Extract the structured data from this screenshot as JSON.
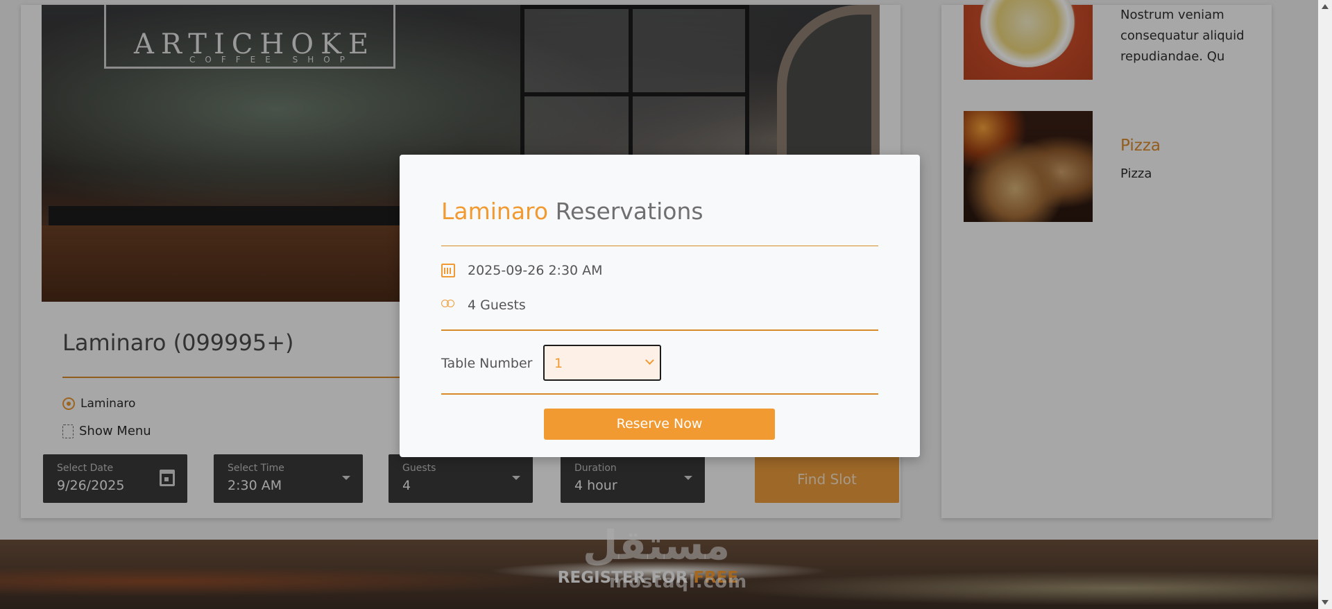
{
  "restaurant": {
    "title": "Laminaro (099995+)",
    "location": "Laminaro",
    "show_menu": "Show Menu"
  },
  "hero": {
    "sign_main": "ARTICHOKE",
    "sign_sub": "COFFEE SHOP"
  },
  "search": {
    "date_label": "Select Date",
    "date_value": "9/26/2025",
    "time_label": "Select Time",
    "time_value": "2:30 AM",
    "guests_label": "Guests",
    "guests_value": "4",
    "duration_label": "Duration",
    "duration_value": "4 hour",
    "find_button": "Find Slot"
  },
  "sidebar": {
    "item1_text": "Nostrum veniam consequatur aliquid repudiandae. Qu",
    "item2_title": "Pizza",
    "item2_text": "Pizza"
  },
  "footer": {
    "register": "REGISTER FOR",
    "free": "FREE",
    "watermark": "مستقل",
    "watermark_sub": "mostaql.com"
  },
  "modal": {
    "title_brand": "Laminaro",
    "title_rest": "Reservations",
    "datetime": "2025-09-26 2:30 AM",
    "guests": "4 Guests",
    "table_label": "Table Number",
    "table_value": "1",
    "reserve_button": "Reserve Now"
  },
  "colors": {
    "accent": "#f29a32",
    "dark_field": "#393939"
  },
  "icons": [
    "location-icon",
    "menu-icon",
    "calendar-icon",
    "guests-icon",
    "chevron-down-icon"
  ]
}
